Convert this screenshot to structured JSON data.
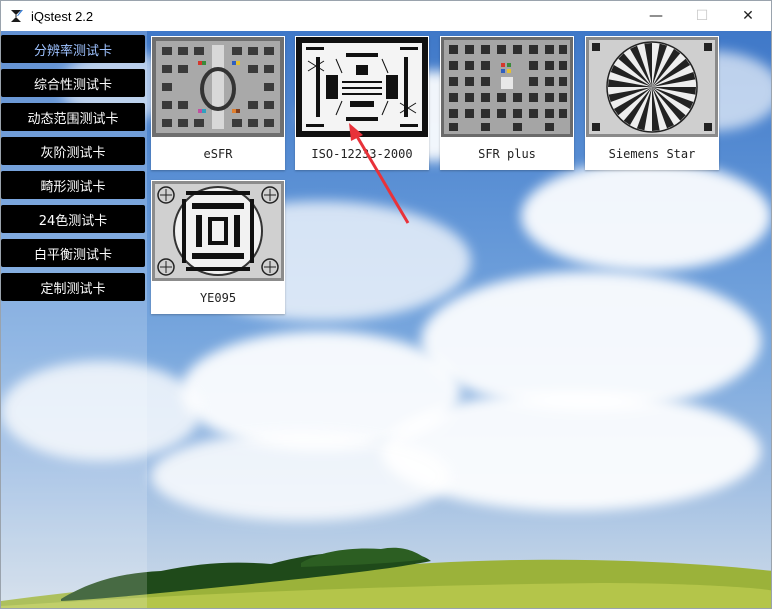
{
  "window": {
    "title": "iQstest 2.2",
    "controls": [
      "—",
      "☐",
      "✕"
    ]
  },
  "sidebar": {
    "items": [
      {
        "label": "分辨率测试卡",
        "active": true
      },
      {
        "label": "综合性测试卡",
        "active": false
      },
      {
        "label": "动态范围测试卡",
        "active": false
      },
      {
        "label": "灰阶测试卡",
        "active": false
      },
      {
        "label": "畸形测试卡",
        "active": false
      },
      {
        "label": "24色测试卡",
        "active": false
      },
      {
        "label": "白平衡测试卡",
        "active": false
      },
      {
        "label": "定制测试卡",
        "active": false
      }
    ]
  },
  "cards": [
    {
      "label": "eSFR"
    },
    {
      "label": "ISO-12233-2000"
    },
    {
      "label": "SFR plus"
    },
    {
      "label": "Siemens Star"
    },
    {
      "label": "YE095"
    }
  ],
  "colors": {
    "sidebar_bg": "#000000",
    "sidebar_active_text": "#9ec2ff",
    "annotation_arrow": "#e8323a"
  }
}
